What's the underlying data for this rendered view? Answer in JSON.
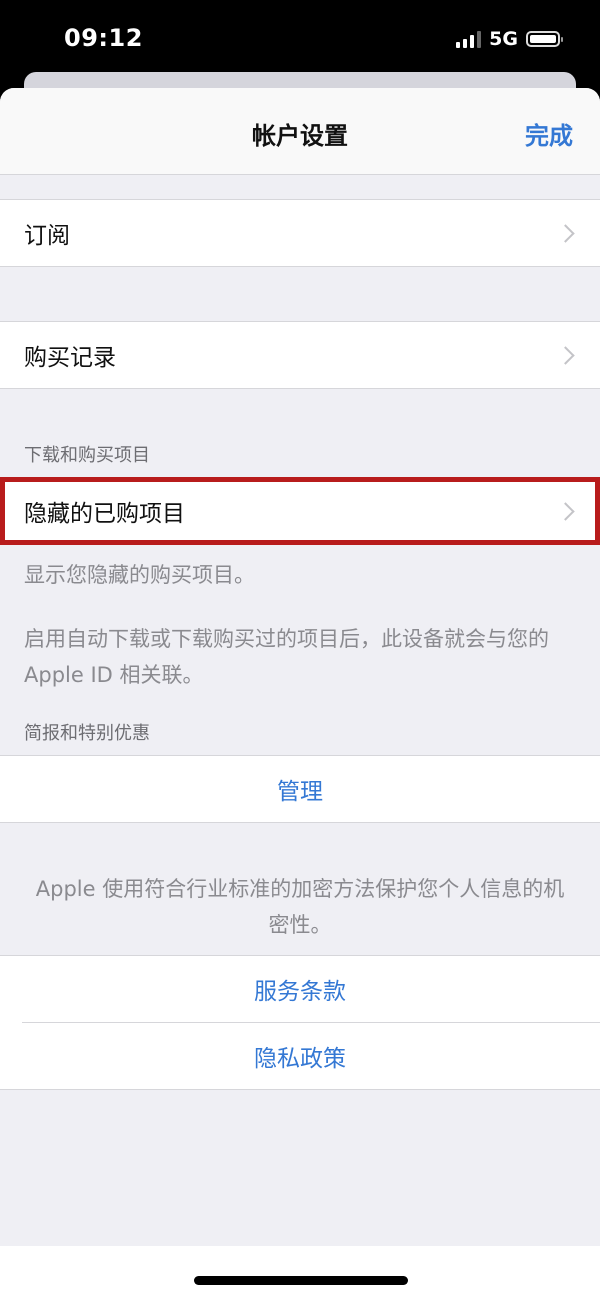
{
  "status_bar": {
    "time": "09:12",
    "network": "5G",
    "signal_icon": "cellular-signal-icon",
    "battery_icon": "battery-icon"
  },
  "navbar": {
    "title": "帐户设置",
    "done_label": "完成"
  },
  "rows": {
    "subscriptions": "订阅",
    "purchase_history": "购买记录"
  },
  "downloads_section": {
    "header": "下载和购买项目",
    "hidden_purchases": "隐藏的已购项目",
    "hidden_purchases_footer": "显示您隐藏的购买项目。",
    "association_note": "启用自动下载或下载购买过的项目后，此设备就会与您的 Apple ID 相关联。"
  },
  "newsletters_section": {
    "header": "简报和特别优惠",
    "manage_label": "管理"
  },
  "privacy_note": "Apple 使用符合行业标准的加密方法保护您个人信息的机密性。",
  "legal_links": [
    {
      "label": "服务条款"
    },
    {
      "label": "隐私政策"
    }
  ],
  "colors": {
    "accent": "#3478d4",
    "highlight_box": "#b81c1c",
    "grouped_background": "#efeff4"
  }
}
